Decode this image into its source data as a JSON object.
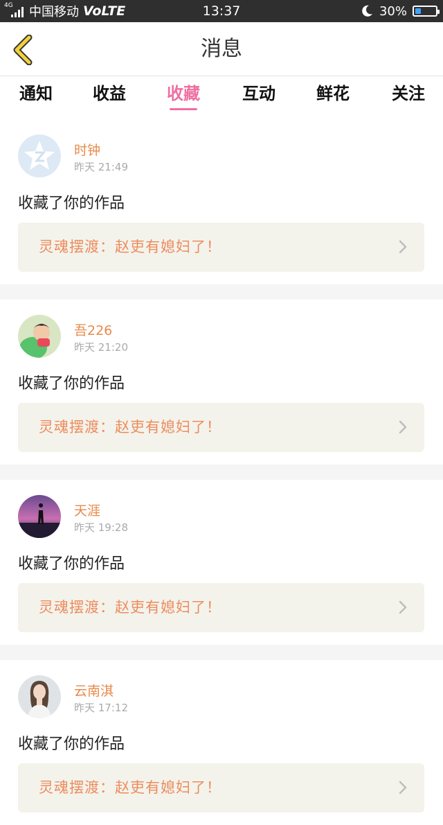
{
  "status_bar": {
    "signal_label": "4G",
    "carrier": "中国移动",
    "network": "VoLTE",
    "time": "13:37",
    "battery_percent": "30%",
    "battery_level": 0.3
  },
  "header": {
    "back_icon": "chevron-left-icon",
    "title": "消息"
  },
  "tabs": [
    {
      "label": "通知",
      "active": false
    },
    {
      "label": "收益",
      "active": false
    },
    {
      "label": "收藏",
      "active": true
    },
    {
      "label": "互动",
      "active": false
    },
    {
      "label": "鲜花",
      "active": false
    },
    {
      "label": "关注",
      "active": false
    }
  ],
  "colors": {
    "accent": "#ef6fa2",
    "username": "#e8894a",
    "work_title": "#ee8b5c",
    "work_bg": "#f3f3ec"
  },
  "notifications": [
    {
      "username": "时钟",
      "time": "昨天 21:49",
      "action": "收藏了你的作品",
      "work_title": "灵魂摆渡：赵吏有媳妇了！",
      "avatar": "default-avatar-icon"
    },
    {
      "username": "吾226",
      "time": "昨天 21:20",
      "action": "收藏了你的作品",
      "work_title": "灵魂摆渡：赵吏有媳妇了！",
      "avatar": "child-photo-avatar"
    },
    {
      "username": "天涯",
      "time": "昨天 19:28",
      "action": "收藏了你的作品",
      "work_title": "灵魂摆渡：赵吏有媳妇了！",
      "avatar": "sunset-silhouette-avatar"
    },
    {
      "username": "云南淇",
      "time": "昨天 17:12",
      "action": "收藏了你的作品",
      "work_title": "灵魂摆渡：赵吏有媳妇了！",
      "avatar": "woman-photo-avatar"
    }
  ]
}
